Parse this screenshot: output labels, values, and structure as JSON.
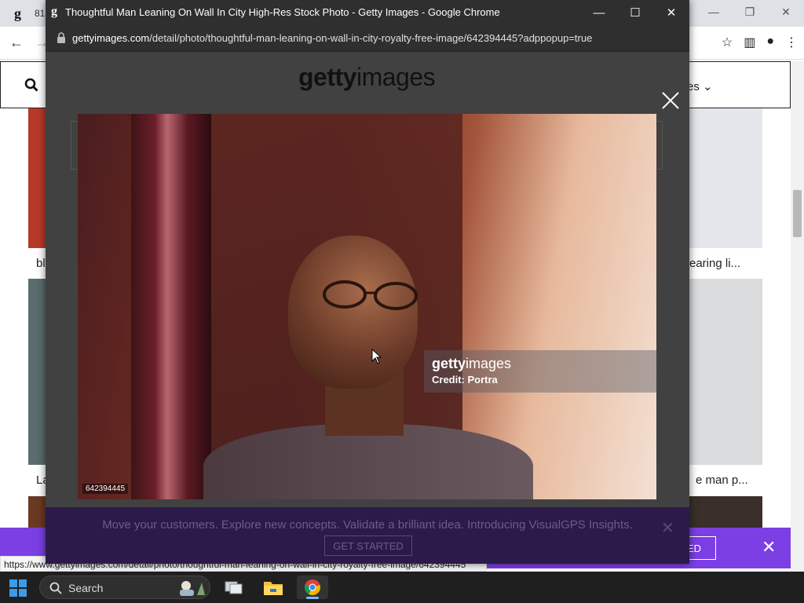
{
  "background_window": {
    "favicon_glyph": "g",
    "tab_text_fragment": "81",
    "captions": [
      {
        "text": "bl"
      },
      {
        "text": "earing li..."
      },
      {
        "text": "La"
      },
      {
        "text": "e man p..."
      }
    ],
    "header_right_text": "es",
    "banner_button_label": "ED",
    "status_url": "https://www.gettyimages.com/detail/photo/thoughtful-man-leaning-on-wall-in-city-royalty-free-image/642394445"
  },
  "popup": {
    "window_title": "Thoughtful Man Leaning On Wall In City High-Res Stock Photo - Getty Images - Google Chrome",
    "url_domain": "gettyimages.com",
    "url_path": "/detail/photo/thoughtful-man-leaning-on-wall-in-city-royalty-free-image/642394445?adppopup=true",
    "logo_left": "getty",
    "logo_right": "images",
    "photo": {
      "overlay_logo_left": "getty",
      "overlay_logo_right": "images",
      "credit": "Credit: Portra",
      "image_id": "642394445"
    },
    "promo": {
      "text": "Move your customers. Explore new concepts. Validate a brilliant idea. Introducing VisualGPS Insights.",
      "button_label": "GET STARTED"
    }
  },
  "taskbar": {
    "search_label": "Search"
  },
  "colors": {
    "accent_purple": "#7b3fe4",
    "popup_bg": "#3b3b3b",
    "promo_bg": "#2b1a4a"
  }
}
